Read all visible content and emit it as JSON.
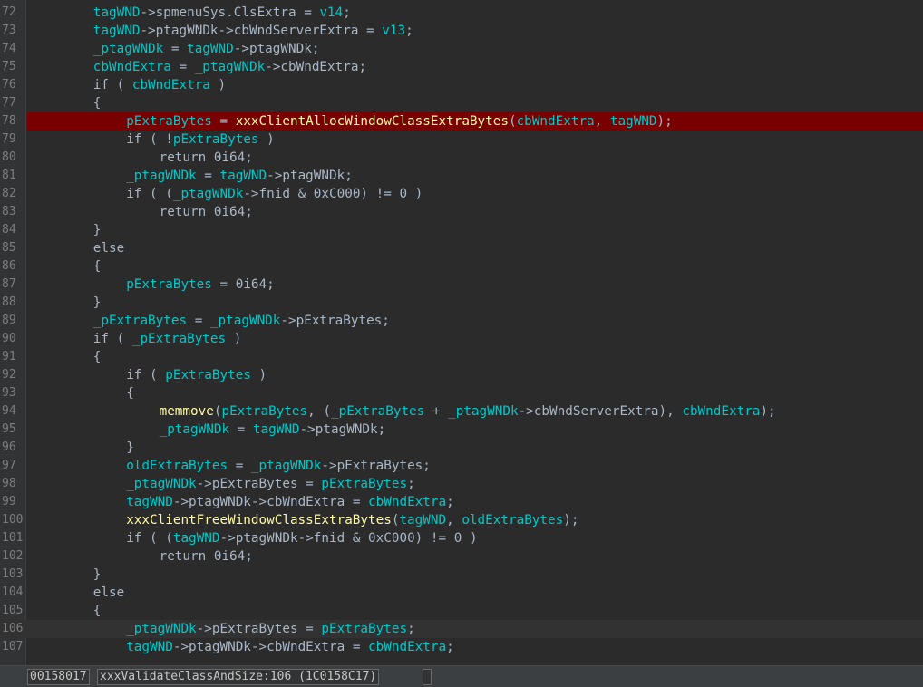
{
  "editor": {
    "current_line": "106",
    "breakpoint_line": "78",
    "lines": [
      {
        "n": "72",
        "indent": 4,
        "tokens": [
          [
            "v",
            "tagWND"
          ],
          [
            "p",
            "->spmenuSys.ClsExtra = "
          ],
          [
            "v",
            "v14"
          ],
          [
            "p",
            ";"
          ]
        ]
      },
      {
        "n": "73",
        "indent": 4,
        "tokens": [
          [
            "v",
            "tagWND"
          ],
          [
            "p",
            "->ptagWNDk->cbWndServerExtra = "
          ],
          [
            "v",
            "v13"
          ],
          [
            "p",
            ";"
          ]
        ]
      },
      {
        "n": "74",
        "indent": 4,
        "tokens": [
          [
            "v",
            "_ptagWNDk"
          ],
          [
            "p",
            " = "
          ],
          [
            "v",
            "tagWND"
          ],
          [
            "p",
            "->ptagWNDk;"
          ]
        ]
      },
      {
        "n": "75",
        "indent": 4,
        "tokens": [
          [
            "v",
            "cbWndExtra"
          ],
          [
            "p",
            " = "
          ],
          [
            "v",
            "_ptagWNDk"
          ],
          [
            "p",
            "->cbWndExtra;"
          ]
        ]
      },
      {
        "n": "76",
        "indent": 4,
        "tokens": [
          [
            "p",
            "if ( "
          ],
          [
            "v",
            "cbWndExtra"
          ],
          [
            "p",
            " )"
          ]
        ]
      },
      {
        "n": "77",
        "indent": 4,
        "tokens": [
          [
            "p",
            "{"
          ]
        ]
      },
      {
        "n": "78",
        "indent": 6,
        "tokens": [
          [
            "v",
            "pExtraBytes"
          ],
          [
            "p",
            " = "
          ],
          [
            "f",
            "xxxClientAllocWindowClassExtraBytes"
          ],
          [
            "p",
            "("
          ],
          [
            "v",
            "cbWndExtra"
          ],
          [
            "p",
            ", "
          ],
          [
            "v",
            "tagWND"
          ],
          [
            "p",
            ");"
          ]
        ]
      },
      {
        "n": "79",
        "indent": 6,
        "tokens": [
          [
            "p",
            "if ( !"
          ],
          [
            "v",
            "pExtraBytes"
          ],
          [
            "p",
            " )"
          ]
        ]
      },
      {
        "n": "80",
        "indent": 8,
        "tokens": [
          [
            "p",
            "return 0i64;"
          ]
        ]
      },
      {
        "n": "81",
        "indent": 6,
        "tokens": [
          [
            "v",
            "_ptagWNDk"
          ],
          [
            "p",
            " = "
          ],
          [
            "v",
            "tagWND"
          ],
          [
            "p",
            "->ptagWNDk;"
          ]
        ]
      },
      {
        "n": "82",
        "indent": 6,
        "tokens": [
          [
            "p",
            "if ( ("
          ],
          [
            "v",
            "_ptagWNDk"
          ],
          [
            "p",
            "->fnid & 0xC000) != 0 )"
          ]
        ]
      },
      {
        "n": "83",
        "indent": 8,
        "tokens": [
          [
            "p",
            "return 0i64;"
          ]
        ]
      },
      {
        "n": "84",
        "indent": 4,
        "tokens": [
          [
            "p",
            "}"
          ]
        ]
      },
      {
        "n": "85",
        "indent": 4,
        "tokens": [
          [
            "p",
            "else"
          ]
        ]
      },
      {
        "n": "86",
        "indent": 4,
        "tokens": [
          [
            "p",
            "{"
          ]
        ]
      },
      {
        "n": "87",
        "indent": 6,
        "tokens": [
          [
            "v",
            "pExtraBytes"
          ],
          [
            "p",
            " = 0i64;"
          ]
        ]
      },
      {
        "n": "88",
        "indent": 4,
        "tokens": [
          [
            "p",
            "}"
          ]
        ]
      },
      {
        "n": "89",
        "indent": 4,
        "tokens": [
          [
            "v",
            "_pExtraBytes"
          ],
          [
            "p",
            " = "
          ],
          [
            "v",
            "_ptagWNDk"
          ],
          [
            "p",
            "->pExtraBytes;"
          ]
        ]
      },
      {
        "n": "90",
        "indent": 4,
        "tokens": [
          [
            "p",
            "if ( "
          ],
          [
            "v",
            "_pExtraBytes"
          ],
          [
            "p",
            " )"
          ]
        ]
      },
      {
        "n": "91",
        "indent": 4,
        "tokens": [
          [
            "p",
            "{"
          ]
        ]
      },
      {
        "n": "92",
        "indent": 6,
        "tokens": [
          [
            "p",
            "if ( "
          ],
          [
            "v",
            "pExtraBytes"
          ],
          [
            "p",
            " )"
          ]
        ]
      },
      {
        "n": "93",
        "indent": 6,
        "tokens": [
          [
            "p",
            "{"
          ]
        ]
      },
      {
        "n": "94",
        "indent": 8,
        "tokens": [
          [
            "f",
            "memmove"
          ],
          [
            "p",
            "("
          ],
          [
            "v",
            "pExtraBytes"
          ],
          [
            "p",
            ", ("
          ],
          [
            "v",
            "_pExtraBytes"
          ],
          [
            "p",
            " + "
          ],
          [
            "v",
            "_ptagWNDk"
          ],
          [
            "p",
            "->cbWndServerExtra), "
          ],
          [
            "v",
            "cbWndExtra"
          ],
          [
            "p",
            ");"
          ]
        ]
      },
      {
        "n": "95",
        "indent": 8,
        "tokens": [
          [
            "v",
            "_ptagWNDk"
          ],
          [
            "p",
            " = "
          ],
          [
            "v",
            "tagWND"
          ],
          [
            "p",
            "->ptagWNDk;"
          ]
        ]
      },
      {
        "n": "96",
        "indent": 6,
        "tokens": [
          [
            "p",
            "}"
          ]
        ]
      },
      {
        "n": "97",
        "indent": 6,
        "tokens": [
          [
            "v",
            "oldExtraBytes"
          ],
          [
            "p",
            " = "
          ],
          [
            "v",
            "_ptagWNDk"
          ],
          [
            "p",
            "->pExtraBytes;"
          ]
        ]
      },
      {
        "n": "98",
        "indent": 6,
        "tokens": [
          [
            "v",
            "_ptagWNDk"
          ],
          [
            "p",
            "->pExtraBytes = "
          ],
          [
            "v",
            "pExtraBytes"
          ],
          [
            "p",
            ";"
          ]
        ]
      },
      {
        "n": "99",
        "indent": 6,
        "tokens": [
          [
            "v",
            "tagWND"
          ],
          [
            "p",
            "->ptagWNDk->cbWndExtra = "
          ],
          [
            "v",
            "cbWndExtra"
          ],
          [
            "p",
            ";"
          ]
        ]
      },
      {
        "n": "100",
        "indent": 6,
        "tokens": [
          [
            "f",
            "xxxClientFreeWindowClassExtraBytes"
          ],
          [
            "p",
            "("
          ],
          [
            "v",
            "tagWND"
          ],
          [
            "p",
            ", "
          ],
          [
            "v",
            "oldExtraBytes"
          ],
          [
            "p",
            ");"
          ]
        ]
      },
      {
        "n": "101",
        "indent": 6,
        "tokens": [
          [
            "p",
            "if ( ("
          ],
          [
            "v",
            "tagWND"
          ],
          [
            "p",
            "->ptagWNDk->fnid & 0xC000) != 0 )"
          ]
        ]
      },
      {
        "n": "102",
        "indent": 8,
        "tokens": [
          [
            "p",
            "return 0i64;"
          ]
        ]
      },
      {
        "n": "103",
        "indent": 4,
        "tokens": [
          [
            "p",
            "}"
          ]
        ]
      },
      {
        "n": "104",
        "indent": 4,
        "tokens": [
          [
            "p",
            "else"
          ]
        ]
      },
      {
        "n": "105",
        "indent": 4,
        "tokens": [
          [
            "p",
            "{"
          ]
        ]
      },
      {
        "n": "106",
        "indent": 6,
        "tokens": [
          [
            "v",
            "_ptagWNDk"
          ],
          [
            "p",
            "->pExtraBytes = "
          ],
          [
            "v",
            "pExtraBytes"
          ],
          [
            "p",
            ";"
          ]
        ]
      },
      {
        "n": "107",
        "indent": 6,
        "tokens": [
          [
            "v",
            "tagWND"
          ],
          [
            "p",
            "->ptagWNDk->cbWndExtra = "
          ],
          [
            "v",
            "cbWndExtra"
          ],
          [
            "p",
            ";"
          ]
        ]
      }
    ]
  },
  "status": {
    "address": "00158017",
    "function_location": "xxxValidateClassAndSize:106 (1C0158C17)"
  },
  "colors": {
    "background": "#2b2b2b",
    "breakpoint_line": "#780000",
    "variable": "#00c8c8",
    "function": "#fffaa5",
    "text": "#a9b7c6"
  }
}
